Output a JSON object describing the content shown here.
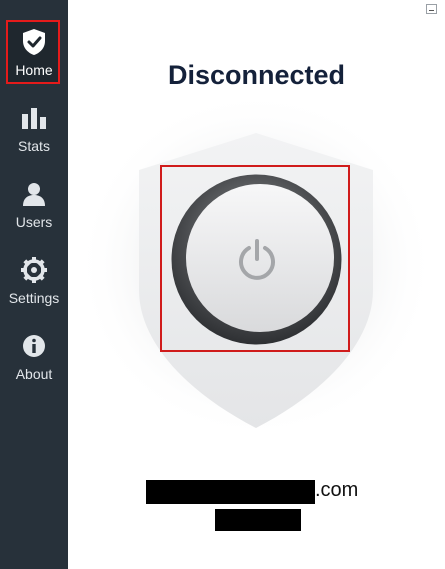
{
  "sidebar": {
    "items": [
      {
        "id": "home",
        "label": "Home",
        "icon": "shield-check-icon",
        "active": true
      },
      {
        "id": "stats",
        "label": "Stats",
        "icon": "bar-chart-icon",
        "active": false
      },
      {
        "id": "users",
        "label": "Users",
        "icon": "user-icon",
        "active": false
      },
      {
        "id": "settings",
        "label": "Settings",
        "icon": "gear-icon",
        "active": false
      },
      {
        "id": "about",
        "label": "About",
        "icon": "info-icon",
        "active": false
      }
    ]
  },
  "window": {
    "minimize_icon": "minimize-icon"
  },
  "main": {
    "status": "Disconnected",
    "power_icon": "power-icon",
    "account": {
      "domain_suffix": ".com"
    }
  },
  "colors": {
    "sidebar_bg": "#27313a",
    "status_text": "#14213a",
    "highlight": "#e51b1b"
  }
}
